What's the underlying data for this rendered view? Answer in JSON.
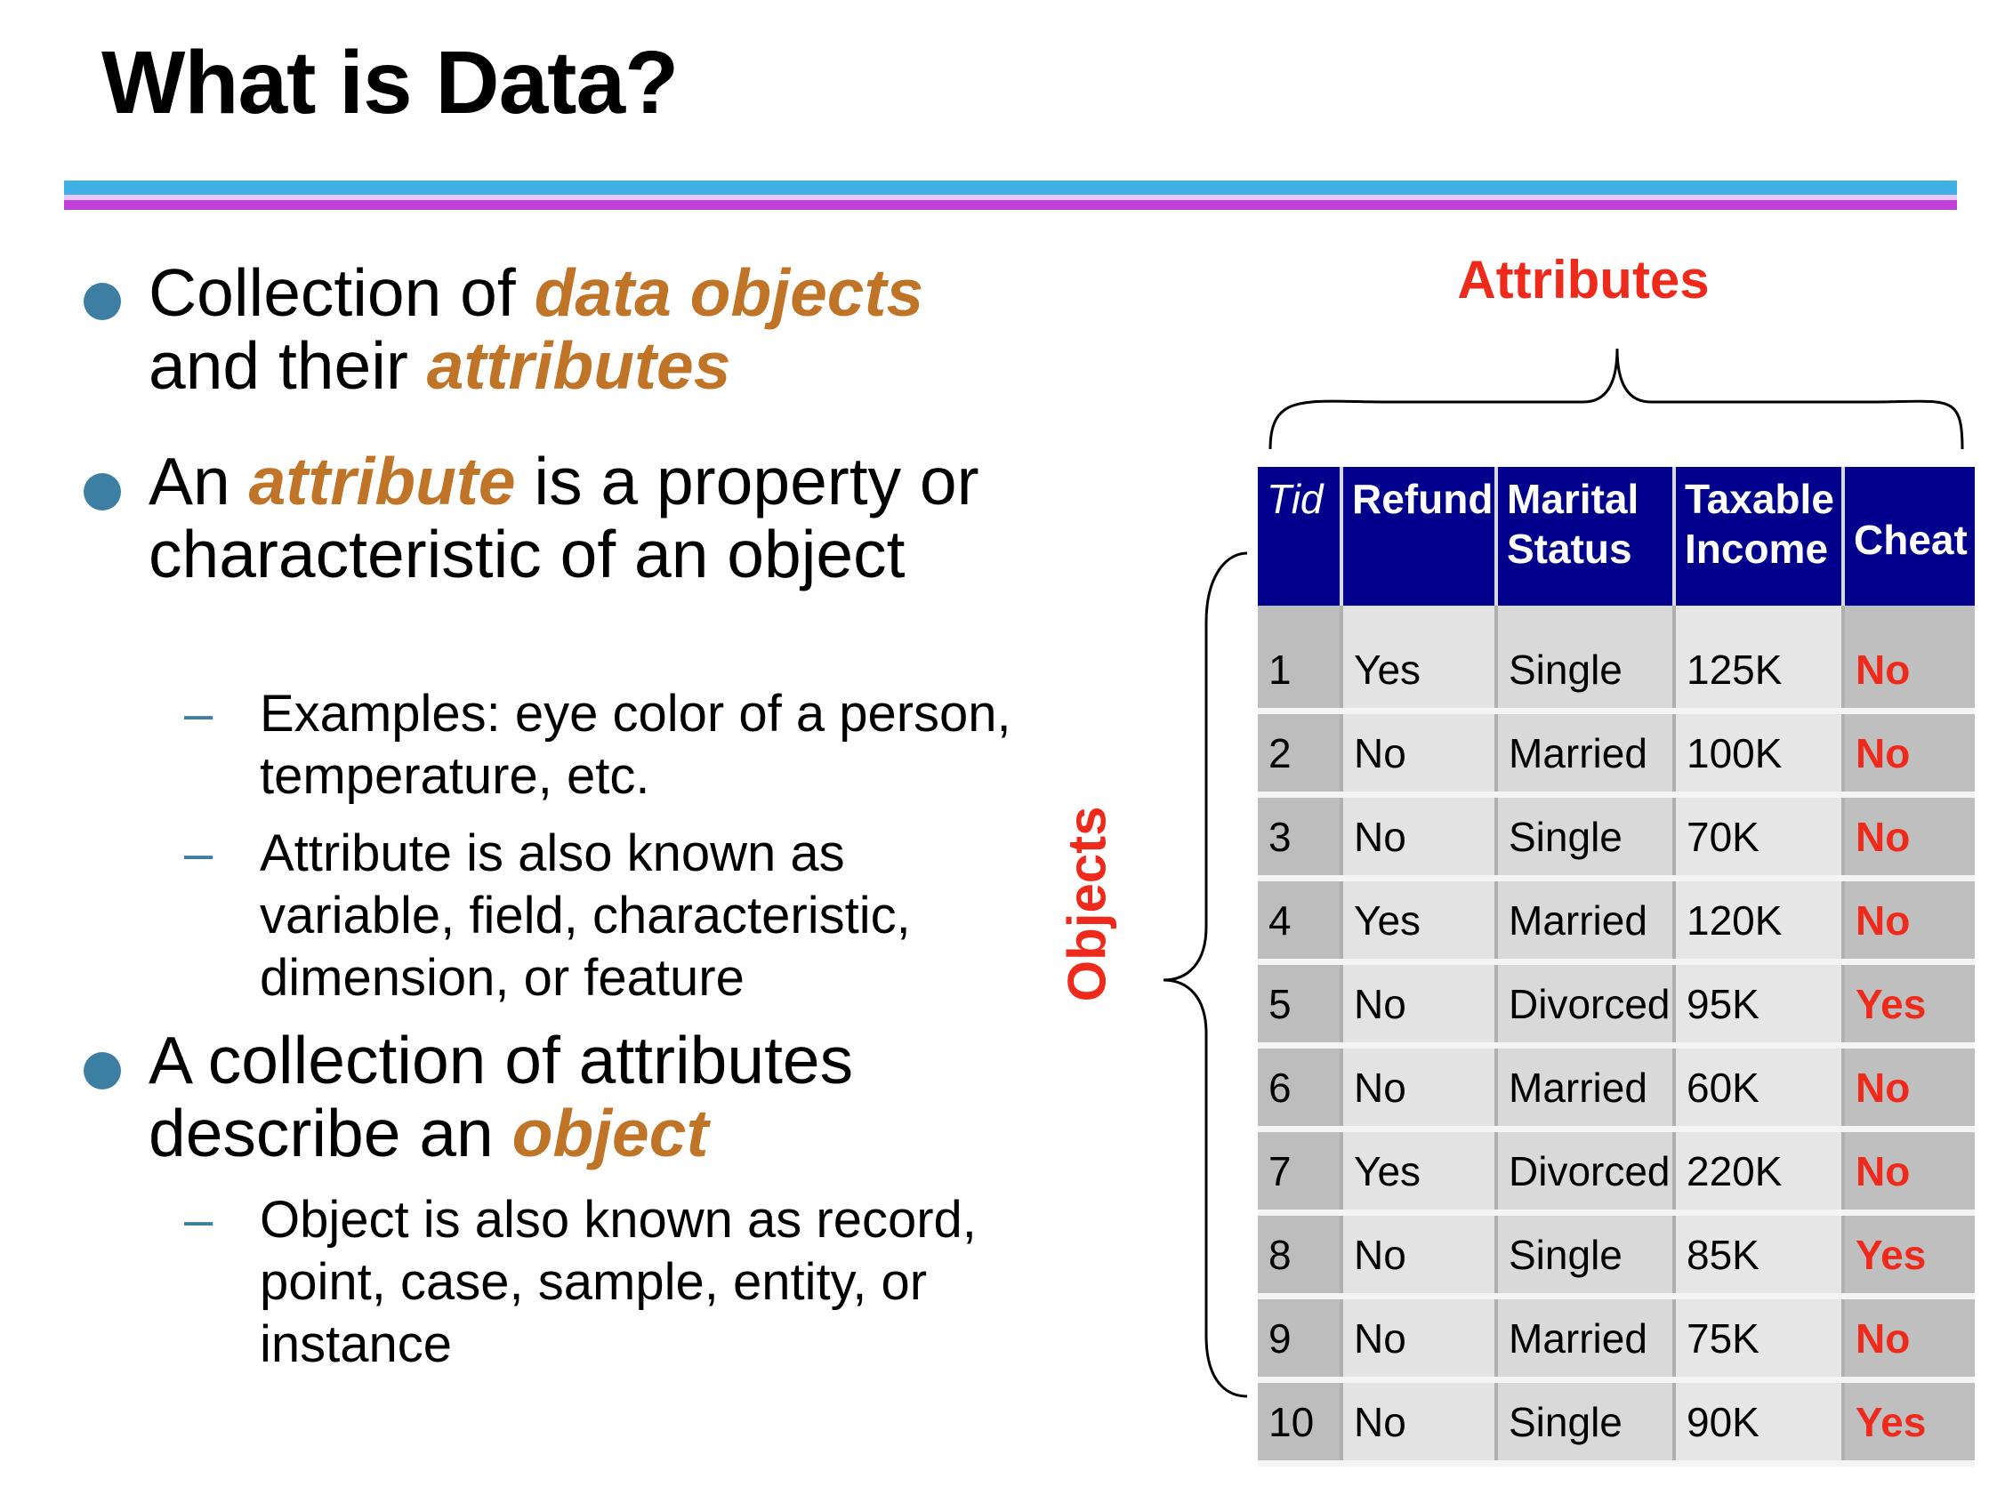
{
  "slide": {
    "title": "What is Data?",
    "bullets": [
      {
        "parts": [
          {
            "t": "Collection of "
          },
          {
            "t": "data objects",
            "em": true
          },
          {
            "t": " and their "
          },
          {
            "t": "attributes",
            "em": true
          }
        ]
      },
      {
        "parts": [
          {
            "t": "An "
          },
          {
            "t": "attribute",
            "em": true
          },
          {
            "t": " is a property or characteristic of an object"
          }
        ]
      },
      {
        "parts": [
          {
            "t": "A collection of attributes describe an "
          },
          {
            "t": "object",
            "em": true
          }
        ]
      }
    ],
    "subbullets": [
      "Examples: eye color of a person, temperature, etc.",
      "Attribute is also known as variable, field, characteristic, dimension, or feature",
      "Object is also known as record, point, case, sample, entity, or instance"
    ],
    "dash_glyph": "–",
    "labels": {
      "attributes": "Attributes",
      "objects": "Objects"
    }
  },
  "table": {
    "headers": [
      "Tid",
      "Refund",
      "Marital Status",
      "Taxable Income",
      "Cheat"
    ],
    "rows": [
      [
        "1",
        "Yes",
        "Single",
        "125K",
        "No"
      ],
      [
        "2",
        "No",
        "Married",
        "100K",
        "No"
      ],
      [
        "3",
        "No",
        "Single",
        "70K",
        "No"
      ],
      [
        "4",
        "Yes",
        "Married",
        "120K",
        "No"
      ],
      [
        "5",
        "No",
        "Divorced",
        "95K",
        "Yes"
      ],
      [
        "6",
        "No",
        "Married",
        "60K",
        "No"
      ],
      [
        "7",
        "Yes",
        "Divorced",
        "220K",
        "No"
      ],
      [
        "8",
        "No",
        "Single",
        "85K",
        "Yes"
      ],
      [
        "9",
        "No",
        "Married",
        "75K",
        "No"
      ],
      [
        "10",
        "No",
        "Single",
        "90K",
        "Yes"
      ]
    ]
  },
  "colors": {
    "accent": "#c07428",
    "label_red": "#ee2a1d",
    "bullet_blue": "#3d7fa3",
    "header_navy": "#00008c",
    "rule_cyan": "#40b0e4",
    "rule_magenta": "#c040d8"
  }
}
